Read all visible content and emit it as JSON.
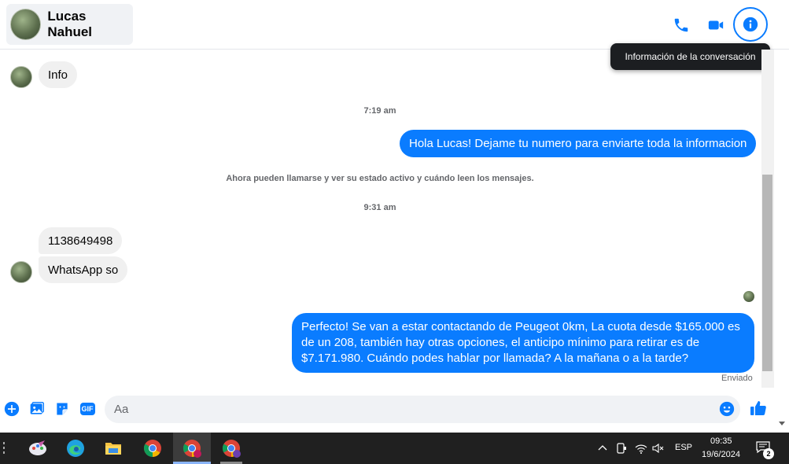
{
  "header": {
    "contact_name": "Lucas Nahuel",
    "tooltip": "Información de la conversación"
  },
  "icons": {
    "phone": "phone-icon",
    "video": "video-camera-icon",
    "info": "info-icon"
  },
  "messages": [
    {
      "type": "in",
      "text": "Info"
    },
    {
      "type": "timestamp",
      "text": "7:19 am"
    },
    {
      "type": "out",
      "text": "Hola Lucas! Dejame tu numero para enviarte toda la informacion"
    },
    {
      "type": "system",
      "text": "Ahora pueden llamarse y ver su estado activo y cuándo leen los mensajes."
    },
    {
      "type": "timestamp",
      "text": "9:31 am"
    },
    {
      "type": "in",
      "text": "1138649498"
    },
    {
      "type": "in",
      "text": "WhatsApp so"
    },
    {
      "type": "out",
      "lines": [
        "Perfecto!  Se van a estar contactando de Peugeot 0km, La cuota desde $165.000 es",
        "de un 208, también hay otras opciones, el anticipo mínimo para retirar es de",
        "$7.171.980. Cuándo podes hablar por llamada? A la mañana o a la tarde?"
      ]
    }
  ],
  "status": "Enviado",
  "composer": {
    "placeholder": "Aa",
    "gif_label": "GIF"
  },
  "taskbar": {
    "language": "ESP",
    "time": "09:35",
    "date": "19/6/2024",
    "notification_count": "2"
  },
  "colors": {
    "accent": "#0a7cff",
    "incoming_bubble": "#f0f0f0",
    "taskbar": "#202020"
  }
}
